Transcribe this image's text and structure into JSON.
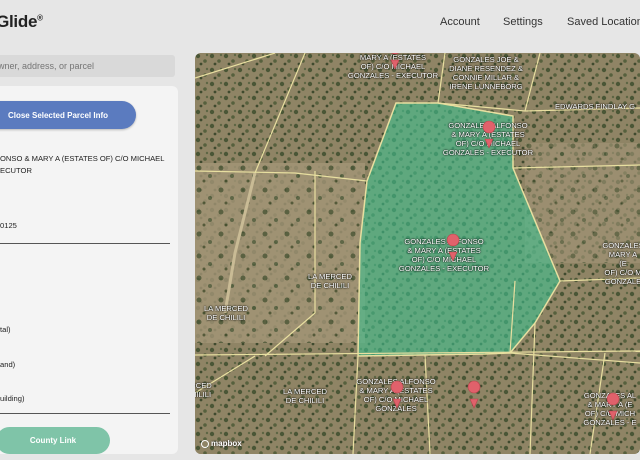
{
  "header": {
    "logo": "dGlide",
    "logo_mark": "®",
    "nav": [
      "Account",
      "Settings",
      "Saved Locations"
    ]
  },
  "search": {
    "placeholder": "wner, address, or parcel"
  },
  "panel": {
    "close_button": "Close Selected Parcel Info",
    "owner_line1": "ONSO & MARY A (ESTATES OF) C/O MICHAEL",
    "owner_line2": "ECUTOR",
    "parcel_id": "0125",
    "row_total": "tal)",
    "row_land": "and)",
    "row_building": "uilding)",
    "county_button": "County Link"
  },
  "map": {
    "attribution": "mapbox",
    "selected_color": "#3fbf8f",
    "line_color": "#e8dfa0",
    "pin_color": "#e0616b",
    "labels": [
      {
        "text": "MARY A (ESTATES\nOF) C/O MICHAEL\nGONZALES - EXECUTOR"
      },
      {
        "text": "GONZALES JOE &\nDIANE RESENDEZ &\nCONNIE MILLAR &\nIRENE LUNNEBORG"
      },
      {
        "text": "EDWARDS FINDLAY G"
      },
      {
        "text": "GONZALES ALFONSO\n& MARY A (ESTATES\nOF) C/O MICHAEL\nGONZALES - EXECUTOR"
      },
      {
        "text": "GONZALES ALFONSO\n& MARY A (ESTATES\nOF) C/O MICHAEL\nGONZALES - EXECUTOR"
      },
      {
        "text": "LA MERCED\nDE CHILILI"
      },
      {
        "text": "LA MERCED\nDE CHILILI"
      },
      {
        "text": "GONZALES\nMARY A\n(E\nOF) C/O M\nGONZALE"
      },
      {
        "text": "RCED\nHILILI"
      },
      {
        "text": "LA MERCED\nDE CHILILI"
      },
      {
        "text": "GONZALES ALFONSO\n& MARY A (ESTATES\nOF) C/O MICHAEL\nGONZALES"
      },
      {
        "text": "GONZALES AL\n& MARY A (E\nOF) C/O MICH\nGONZALES - E"
      }
    ]
  }
}
